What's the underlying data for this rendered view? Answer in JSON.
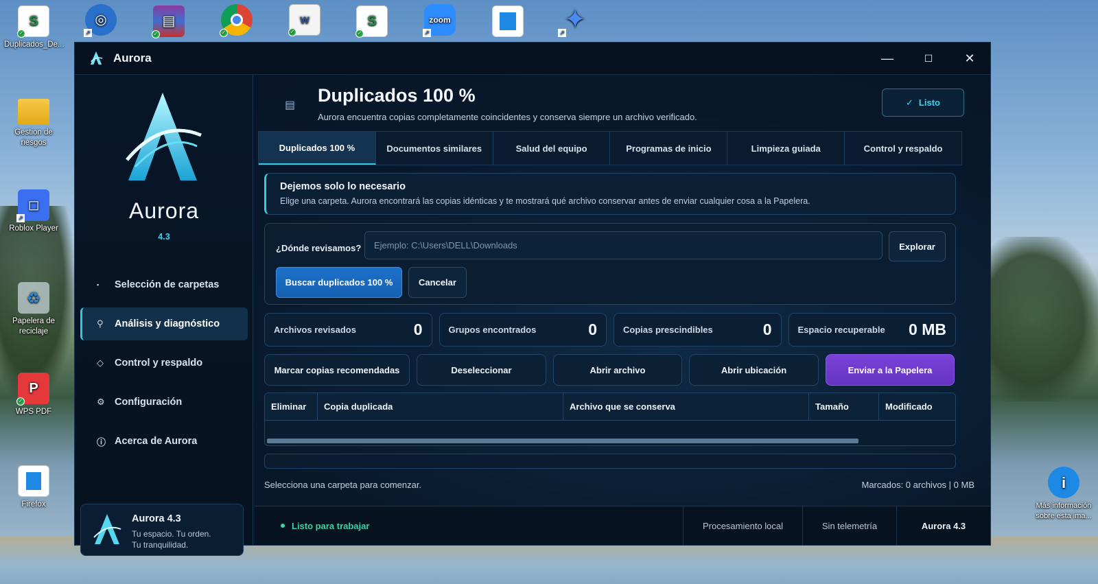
{
  "desktop": {
    "icons_top": [
      {
        "name": "sheets-file",
        "label": "Duplicados_De..."
      },
      {
        "name": "app-shortcut-1",
        "label": ""
      },
      {
        "name": "winrar",
        "label": ""
      },
      {
        "name": "chrome",
        "label": ""
      },
      {
        "name": "word-doc",
        "label": ""
      },
      {
        "name": "sheets-file-2",
        "label": ""
      },
      {
        "name": "zoom",
        "label": ""
      },
      {
        "name": "app-window",
        "label": ""
      },
      {
        "name": "gemini",
        "label": ""
      }
    ],
    "icons_left": [
      {
        "label": "Gestion de riesgos"
      },
      {
        "label": "Roblox Player"
      },
      {
        "label": "Papelera de reciclaje"
      },
      {
        "label": "WPS PDF"
      },
      {
        "label": "Firefox"
      }
    ],
    "info_icon_label": "Más información sobre esta ima..."
  },
  "window": {
    "title": "Aurora",
    "controls": {
      "minimize": "—",
      "maximize": "☐",
      "close": "✕"
    }
  },
  "sidebar": {
    "title": "Aurora",
    "version": "4.3",
    "items": [
      {
        "label": "Selección de carpetas",
        "icon": "folder-icon"
      },
      {
        "label": "Análisis y diagnóstico",
        "icon": "search-icon",
        "active": true
      },
      {
        "label": "Control y respaldo",
        "icon": "diamond-icon"
      },
      {
        "label": "Configuración",
        "icon": "gear-icon"
      },
      {
        "label": "Acerca de Aurora",
        "icon": "info-icon"
      }
    ],
    "card": {
      "title": "Aurora 4.3",
      "line1": "Tu espacio. Tu orden.",
      "line2": "Tu tranquilidad."
    }
  },
  "header": {
    "title": "Duplicados 100 %",
    "subtitle": "Aurora encuentra copias completamente coincidentes y conserva siempre un archivo verificado.",
    "ready_button": "Listo",
    "ready_icon": "✓"
  },
  "tabs": [
    {
      "label": "Duplicados 100 %",
      "active": true
    },
    {
      "label": "Documentos similares"
    },
    {
      "label": "Salud del equipo"
    },
    {
      "label": "Programas de inicio"
    },
    {
      "label": "Limpieza guiada"
    },
    {
      "label": "Control y respaldo"
    }
  ],
  "notice": {
    "title": "Dejemos solo lo necesario",
    "body": "Elige una carpeta. Aurora encontrará las copias idénticas y te mostrará qué archivo conservar antes de enviar cualquier cosa a la Papelera."
  },
  "search": {
    "label": "¿Dónde revisamos?",
    "placeholder": "Ejemplo: C:\\Users\\DELL\\Downloads",
    "value": "",
    "browse_button": "Explorar",
    "scan_button": "Buscar duplicados 100 %",
    "cancel_button": "Cancelar"
  },
  "stats": [
    {
      "label": "Archivos revisados",
      "value": "0"
    },
    {
      "label": "Grupos encontrados",
      "value": "0"
    },
    {
      "label": "Copias prescindibles",
      "value": "0"
    },
    {
      "label": "Espacio recuperable",
      "value": "0 MB"
    }
  ],
  "actions": {
    "mark": "Marcar copias recomendadas",
    "deselect": "Deseleccionar",
    "open_file": "Abrir archivo",
    "open_location": "Abrir ubicación",
    "send_trash": "Enviar a la Papelera"
  },
  "table": {
    "columns": [
      "Eliminar",
      "Copia duplicada",
      "Archivo que se conserva",
      "Tamaño",
      "Modificado"
    ],
    "rows": []
  },
  "status": {
    "left": "Selecciona una carpeta para comenzar.",
    "right": "Marcados: 0 archivos | 0 MB"
  },
  "footer": {
    "ready": "Listo para trabajar",
    "local": "Procesamiento local",
    "telemetry": "Sin telemetría",
    "version": "Aurora 4.3"
  },
  "colors": {
    "accent": "#37c8e0",
    "primary_button": "#1d70c9",
    "danger_button": "#7a42d8",
    "ready_green": "#39d3a4"
  }
}
